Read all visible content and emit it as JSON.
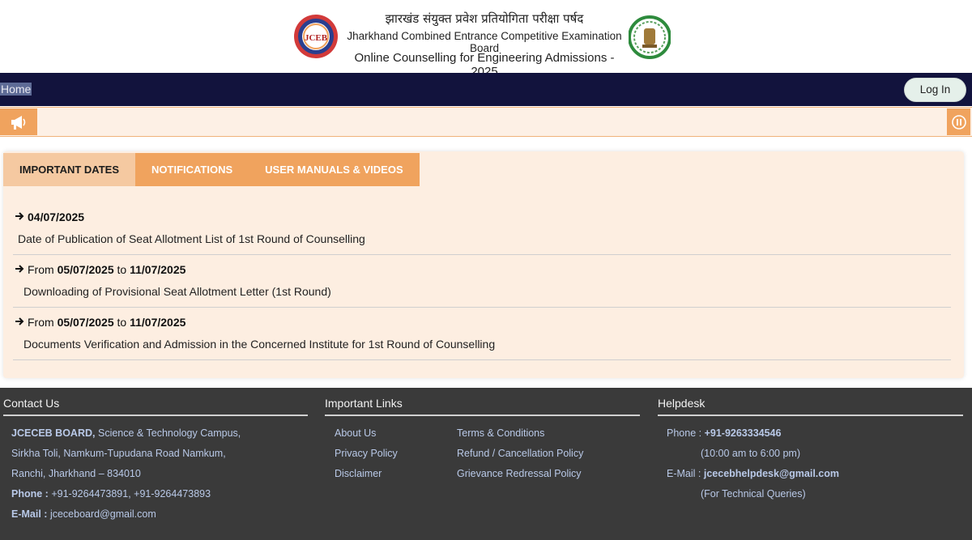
{
  "header": {
    "title_hindi": "झारखंड संयुक्त प्रवेश प्रतियोगिता परीक्षा पर्षद",
    "title_english": "Jharkhand Combined Entrance Competitive Examination Board",
    "subtitle": "Online Counselling for Engineering Admissions - 2025",
    "logo_text": "JCEB"
  },
  "nav": {
    "home_label": "Home",
    "login_label": "Log In"
  },
  "tabs": [
    {
      "label": "IMPORTANT DATES",
      "active": true
    },
    {
      "label": "NOTIFICATIONS",
      "active": false
    },
    {
      "label": "USER MANUALS & VIDEOS",
      "active": false
    }
  ],
  "dates": [
    {
      "prefix": "",
      "date_from": "04/07/2025",
      "connector": "",
      "date_to": "",
      "description": "Date of Publication of Seat Allotment List of 1st Round of Counselling"
    },
    {
      "prefix": "From",
      "date_from": "05/07/2025",
      "connector": "to",
      "date_to": "11/07/2025",
      "description": "Downloading of Provisional Seat Allotment Letter (1st Round)"
    },
    {
      "prefix": "From",
      "date_from": "05/07/2025",
      "connector": "to",
      "date_to": "11/07/2025",
      "description": "Documents Verification and Admission in the Concerned Institute for 1st Round of Counselling"
    }
  ],
  "footer": {
    "contact": {
      "title": "Contact Us",
      "org_name": "JCECEB BOARD,",
      "address1": "Science & Technology Campus,",
      "address2": "Sirkha Toli, Namkum-Tupudana Road Namkum,",
      "address3": "Ranchi, Jharkhand – 834010",
      "phone_label": "Phone :",
      "phone": "+91-9264473891, +91-9264473893",
      "email_label": "E-Mail :",
      "email": "jceceboard@gmail.com"
    },
    "links": {
      "title": "Important Links",
      "items": [
        "About Us",
        "Privacy Policy",
        "Disclaimer",
        "Terms & Conditions",
        "Refund / Cancellation Policy",
        "Grievance Redressal Policy"
      ]
    },
    "helpdesk": {
      "title": "Helpdesk",
      "phone_label": "Phone :",
      "phone": "+91-9263334546",
      "hours": "(10:00 am to 6:00 pm)",
      "email_label": "E-Mail :",
      "email": "jcecebhelpdesk@gmail.com",
      "note": "(For Technical Queries)"
    }
  },
  "colors": {
    "navbar": "#12133d",
    "accent_orange": "#f0a35e",
    "panel_bg": "#fdeee1",
    "footer_bg": "#3a3a3a",
    "footer_text": "#b9c9e8"
  }
}
